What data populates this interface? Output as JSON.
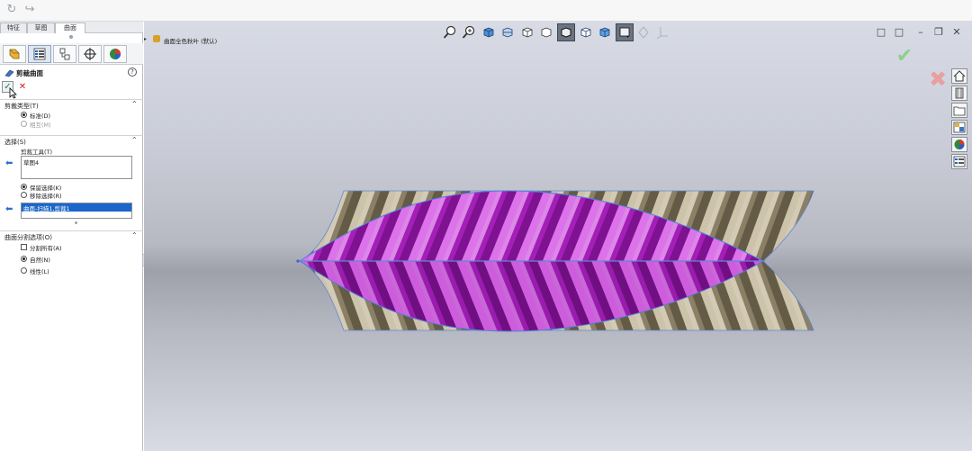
{
  "command_tabs": [
    "特征",
    "草图",
    "曲面"
  ],
  "property_manager": {
    "title": "剪裁曲面",
    "help": "?",
    "trim_type": {
      "header": "剪裁类型(T)",
      "options": [
        "标准(D)",
        "相互(M)"
      ]
    },
    "selections": {
      "header": "选择(S)",
      "trim_tool_label": "剪裁工具(T)",
      "trim_tool_value": "草图4",
      "keep_options": [
        "保留选择(K)",
        "移除选择(R)"
      ],
      "selected_item": "曲面-扫描1,剪裁1"
    },
    "split_options": {
      "header": "曲面分割选项(O)",
      "options": [
        "分割所有(A)",
        "自然(N)",
        "线性(L)"
      ]
    }
  },
  "viewport": {
    "breadcrumb": "曲面全色秋叶  (默认)"
  },
  "colors": {
    "accent_selection": "#1a66c9",
    "surface_magenta": "#b525c9",
    "surface_tan": "#8b7f66",
    "confirm_green": "#1d8a22",
    "cancel_red": "#d02020"
  },
  "icons": [
    "search-icon",
    "zoom-area-icon",
    "previous-view-icon",
    "section-view-icon",
    "view-orientation-icon",
    "display-style-icon",
    "hide-show-icon",
    "edit-appearance-icon",
    "apply-scene-icon",
    "view-settings-icon",
    "home-icon",
    "design-library-icon",
    "file-explorer-icon",
    "view-palette-icon",
    "appearances-icon",
    "custom-properties-icon"
  ]
}
